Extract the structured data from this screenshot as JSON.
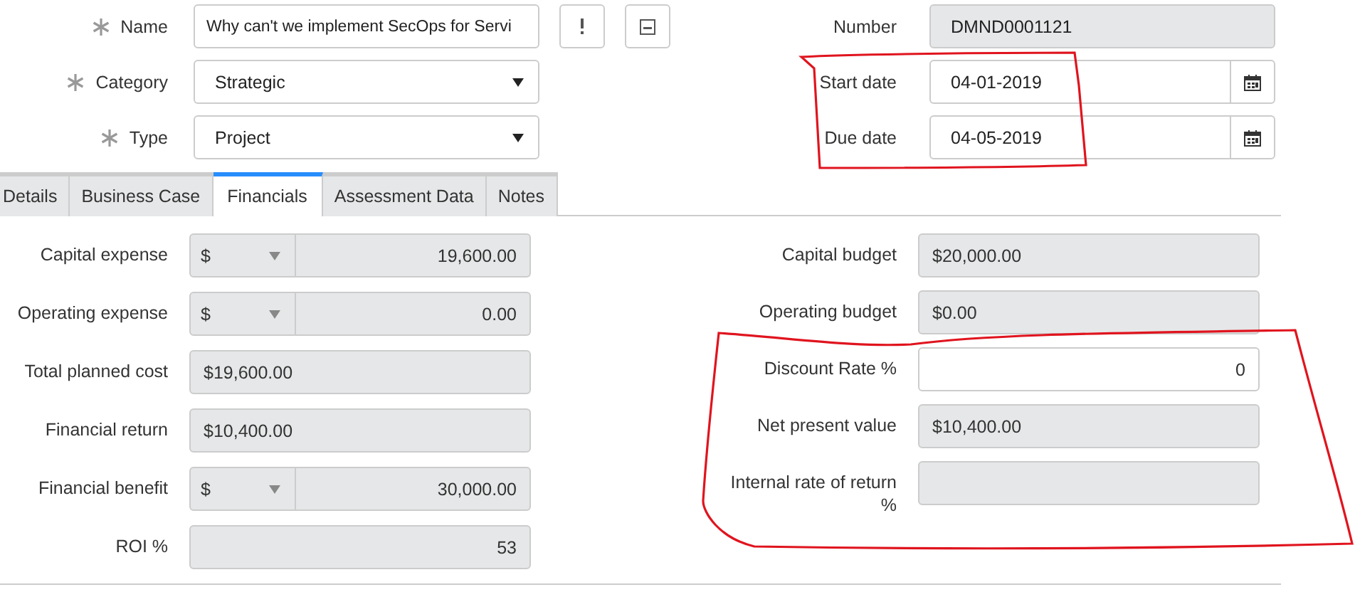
{
  "header": {
    "left": [
      {
        "label": "Name",
        "required": true,
        "kind": "text",
        "value": "Why can't we implement SecOps for Servi",
        "readonly": false
      },
      {
        "label": "Category",
        "required": true,
        "kind": "select",
        "value": "Strategic",
        "readonly": false
      },
      {
        "label": "Type",
        "required": true,
        "kind": "select",
        "value": "Project",
        "readonly": false
      }
    ],
    "right": [
      {
        "label": "Number",
        "kind": "text",
        "value": "DMND0001121",
        "readonly": true
      },
      {
        "label": "Start date",
        "kind": "date",
        "value": "04-01-2019",
        "readonly": false
      },
      {
        "label": "Due date",
        "kind": "date",
        "value": "04-05-2019",
        "readonly": false
      }
    ]
  },
  "tabs": [
    {
      "label": "Details",
      "selected": false
    },
    {
      "label": "Business Case",
      "selected": false
    },
    {
      "label": "Financials",
      "selected": true
    },
    {
      "label": "Assessment Data",
      "selected": false
    },
    {
      "label": "Notes",
      "selected": false
    }
  ],
  "financials": {
    "left": [
      {
        "label": "Capital expense",
        "kind": "currency",
        "currency": "$",
        "value": "19,600.00",
        "readonly": true
      },
      {
        "label": "Operating expense",
        "kind": "currency",
        "currency": "$",
        "value": "0.00",
        "readonly": true
      },
      {
        "label": "Total planned cost",
        "kind": "amount",
        "value": "$19,600.00",
        "readonly": true
      },
      {
        "label": "Financial return",
        "kind": "amount",
        "value": "$10,400.00",
        "readonly": true
      },
      {
        "label": "Financial benefit",
        "kind": "currency",
        "currency": "$",
        "value": "30,000.00",
        "readonly": true
      },
      {
        "label": "ROI %",
        "kind": "number",
        "value": "53",
        "readonly": true
      }
    ],
    "right": [
      {
        "label": "Capital budget",
        "kind": "amount",
        "value": "$20,000.00",
        "readonly": true
      },
      {
        "label": "Operating budget",
        "kind": "amount",
        "value": "$0.00",
        "readonly": true
      },
      {
        "label": "Discount Rate %",
        "kind": "number",
        "value": "0",
        "readonly": false
      },
      {
        "label": "Net present value",
        "kind": "amount",
        "value": "$10,400.00",
        "readonly": true
      },
      {
        "label": "Internal rate of return %",
        "kind": "amount",
        "readonly": true
      }
    ]
  }
}
